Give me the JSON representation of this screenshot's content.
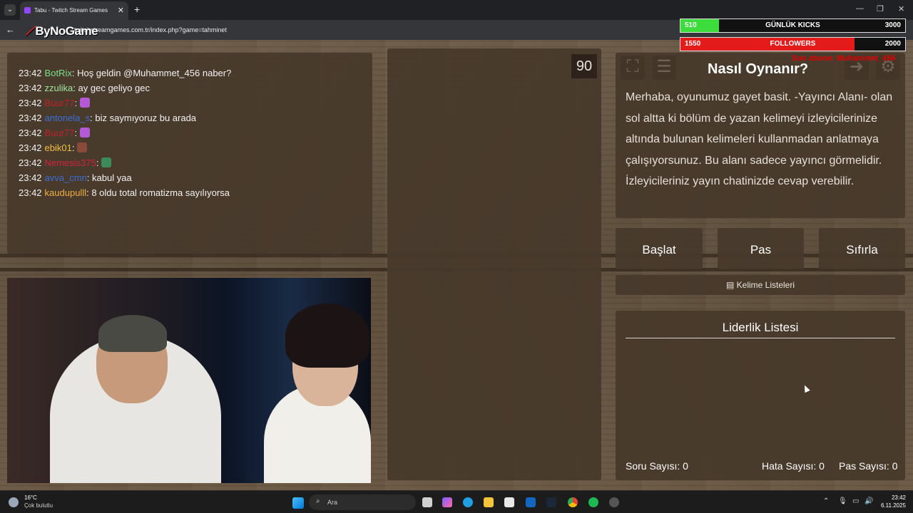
{
  "browser": {
    "tab_title": "Tabu - Twitch Stream Games",
    "url": "twitchstreamgames.com.tr/index.php?game=tahminet"
  },
  "logo": {
    "text": "ByNoGame"
  },
  "overlay": {
    "kicks": {
      "current": "510",
      "label": "GÜNLÜK KICKS",
      "goal": "3000",
      "color": "#3ddc3d",
      "progress": 0.17
    },
    "followers": {
      "current": "1550",
      "label": "FOLLOWERS",
      "goal": "2000",
      "color": "#e31b1b",
      "progress": 0.775
    },
    "last_sub": "Son abone: Muhammet_456"
  },
  "chat": [
    {
      "time": "23:42",
      "user": "BotRix",
      "color": "#7be08a",
      "sep": ": ",
      "msg": "Hoş geldin @Muhammet_456 naber?"
    },
    {
      "time": "23:42",
      "user": "zzulika",
      "color": "#a0e6a0",
      "sep": ": ",
      "msg": "ay gec geliyo gec"
    },
    {
      "time": "23:42",
      "user": "Buur77",
      "color": "#c0222e",
      "sep": ": ",
      "msg": ""
    },
    {
      "time": "23:42",
      "user": "antonela_s",
      "color": "#3a6fd8",
      "sep": ": ",
      "msg": "biz saymıyoruz bu arada"
    },
    {
      "time": "23:42",
      "user": "Buur77",
      "color": "#c0222e",
      "sep": ": ",
      "msg": ""
    },
    {
      "time": "23:42",
      "user": "ebik01",
      "color": "#f0c040",
      "sep": ": ",
      "msg": ""
    },
    {
      "time": "23:42",
      "user": "Nemesis375",
      "color": "#d0243a",
      "sep": ": ",
      "msg": ""
    },
    {
      "time": "23:42",
      "user": "avva_cmn",
      "color": "#3a6fd8",
      "sep": ": ",
      "msg": "kabul yaa"
    },
    {
      "time": "23:42",
      "user": "kaudupulll",
      "color": "#f0b040",
      "sep": ": ",
      "msg": "8 oldu total romatizma sayılıyorsa"
    }
  ],
  "game": {
    "timer": "90",
    "rules_title": "Nasıl Oynanır?",
    "rules_text": "Merhaba, oyunumuz gayet basit. -Yayıncı Alanı- olan sol altta ki bölüm de yazan kelimeyi izleyicilerinize altında bulunan kelimeleri kullanmadan anlatmaya çalışıyorsunuz. Bu alanı sadece yayıncı görmelidir. İzleyicileriniz yayın chatinizde cevap verebilir.",
    "buttons": {
      "start": "Başlat",
      "pass": "Pas",
      "reset": "Sıfırla"
    },
    "word_lists": "Kelime Listeleri",
    "leaderboard_title": "Liderlik Listesi",
    "stats": {
      "questions": "Soru Sayısı: 0",
      "errors": "Hata Sayısı: 0",
      "passes": "Pas Sayısı: 0"
    }
  },
  "taskbar": {
    "weather_temp": "16°C",
    "weather_desc": "Çok bulutlu",
    "search": "Ara",
    "time": "23:42",
    "date": "6.11.2025"
  }
}
